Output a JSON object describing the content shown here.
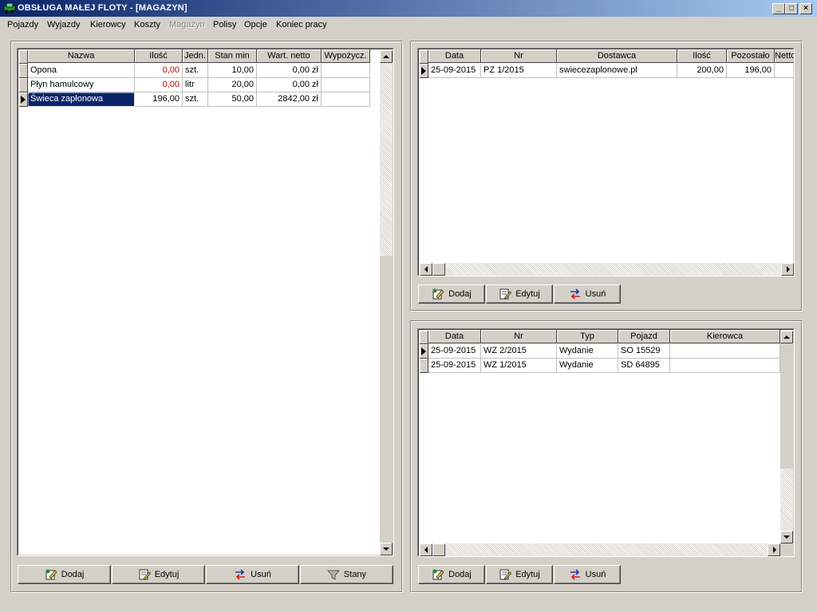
{
  "window": {
    "title": "OBSŁUGA MAŁEJ FLOTY - [MAGAZYN]",
    "controls": {
      "minimize": "_",
      "maximize": "□",
      "close": "×"
    }
  },
  "menu": [
    "Pojazdy",
    "Wyjazdy",
    "Kierowcy",
    "Koszty",
    "Magazyn",
    "Polisy",
    "Opcje",
    "Koniec pracy"
  ],
  "menu_disabled": "Magazyn",
  "left_grid": {
    "columns": [
      "Nazwa",
      "Ilość",
      "Jedn.",
      "Stan min",
      "Wart. netto",
      "Wypożycz."
    ],
    "rows": [
      [
        "Opona",
        "0,00",
        "szt.",
        "10,00",
        "0,00 zł",
        ""
      ],
      [
        "Płyn hamulcowy",
        "0,00",
        "litr",
        "20,00",
        "0,00 zł",
        ""
      ],
      [
        "Świeca zapłonowa",
        "196,00",
        "szt.",
        "50,00",
        "2842,00 zł",
        ""
      ]
    ],
    "selected_row": 2
  },
  "left_buttons": {
    "add": "Dodaj",
    "edit": "Edytuj",
    "delete": "Usuń",
    "states": "Stany"
  },
  "receipts_grid": {
    "columns": [
      "Data",
      "Nr",
      "Dostawca",
      "Ilość",
      "Pozostało",
      "Netto"
    ],
    "rows": [
      [
        "25-09-2015",
        "PZ 1/2015",
        "swiecezaplonowe.pl",
        "200,00",
        "196,00",
        ""
      ]
    ]
  },
  "receipts_buttons": {
    "add": "Dodaj",
    "edit": "Edytuj",
    "delete": "Usuń"
  },
  "issues_grid": {
    "columns": [
      "Data",
      "Nr",
      "Typ",
      "Pojazd",
      "Kierowca"
    ],
    "rows": [
      [
        "25-09-2015",
        "WZ 2/2015",
        "Wydanie",
        "SO 15529",
        ""
      ],
      [
        "25-09-2015",
        "WZ 1/2015",
        "Wydanie",
        "SD 64895",
        ""
      ]
    ]
  },
  "issues_buttons": {
    "add": "Dodaj",
    "edit": "Edytuj",
    "delete": "Usuń"
  },
  "colors": {
    "title_bar": "#0a246a",
    "selection": "#0a246a",
    "zero_quantity": "#c00000",
    "face": "#d4d0c8"
  },
  "icons": {
    "add": "pencil-add-icon",
    "edit": "edit-document-icon",
    "delete": "delete-arrows-icon",
    "states": "funnel-icon"
  }
}
